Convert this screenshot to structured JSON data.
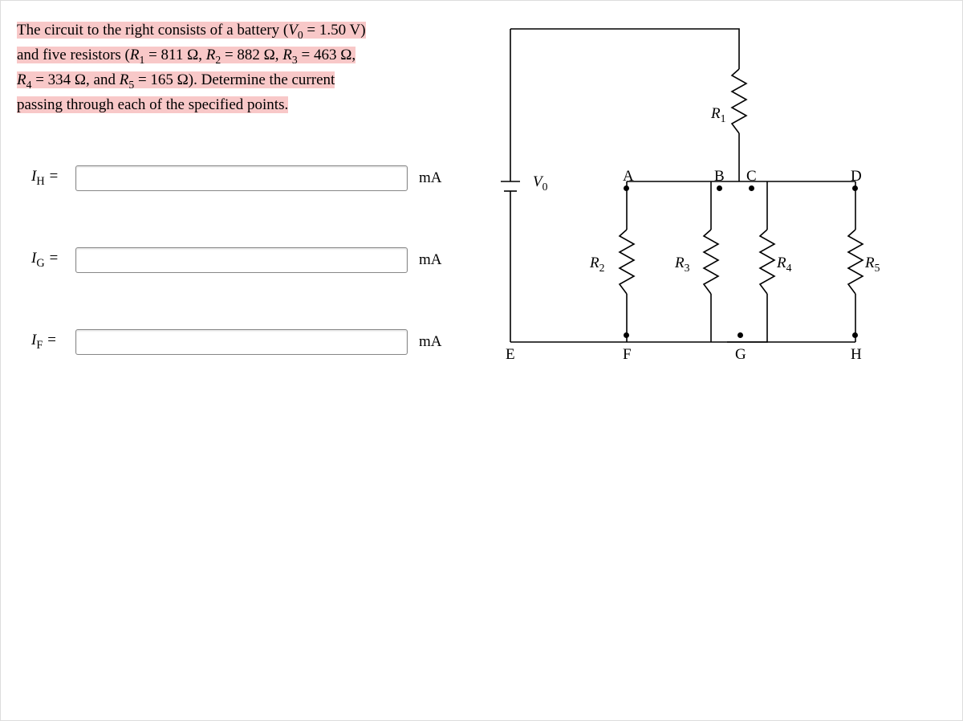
{
  "problem": {
    "line1a": "The circuit to the right consists of a battery (",
    "line1b": " = 1.50 V)",
    "line2a": "and five resistors (",
    "r1": "R",
    "r1sub": "1",
    "eq1": " = 811 Ω, ",
    "r2": "R",
    "r2sub": "2",
    "eq2": " = 882 Ω, ",
    "r3": "R",
    "r3sub": "3",
    "eq3": " = 463 Ω,",
    "line3a": "",
    "r4": "R",
    "r4sub": "4",
    "eq4": " = 334 Ω, and ",
    "r5": "R",
    "r5sub": "5",
    "eq5": " = 165 Ω). Determine the current",
    "line4": "passing through each of the specified points.",
    "V": "V",
    "V0": "0"
  },
  "answers": {
    "IH": {
      "sym": "I",
      "sub": "H",
      "eq": " =",
      "unit": "mA"
    },
    "IG": {
      "sym": "I",
      "sub": "G",
      "eq": " =",
      "unit": "mA"
    },
    "IF": {
      "sym": "I",
      "sub": "F",
      "eq": " =",
      "unit": "mA"
    }
  },
  "diagram": {
    "V0": "V",
    "V0sub": "0",
    "R1": "R",
    "R1s": "1",
    "R2": "R",
    "R2s": "2",
    "R3": "R",
    "R3s": "3",
    "R4": "R",
    "R4s": "4",
    "R5": "R",
    "R5s": "5",
    "A": "A",
    "B": "B",
    "C": "C",
    "D": "D",
    "E": "E",
    "F": "F",
    "G": "G",
    "H": "H"
  }
}
